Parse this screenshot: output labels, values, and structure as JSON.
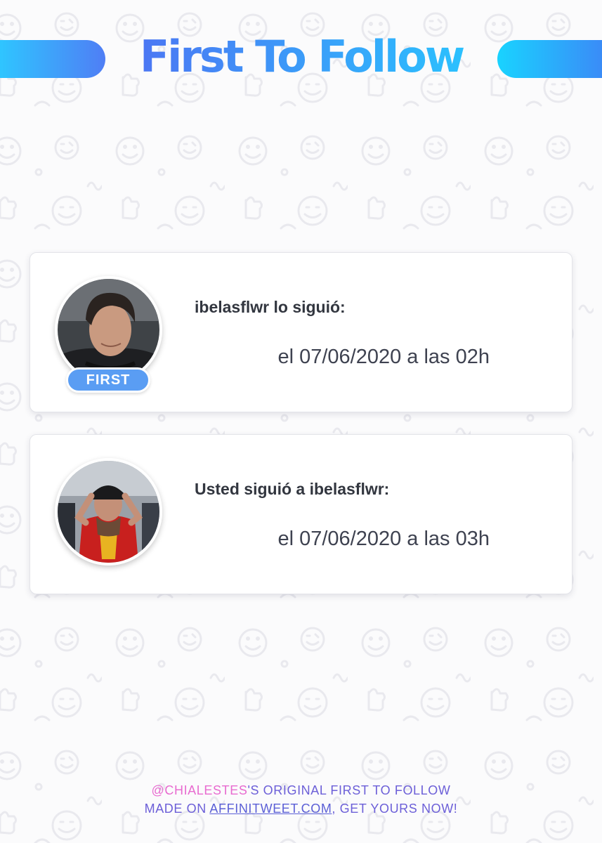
{
  "header": {
    "title": "First To Follow"
  },
  "cards": [
    {
      "label": "ibelasflwr lo siguió:",
      "date": "el 07/06/2020 a las 02h",
      "badge": "FIRST",
      "avatar": "young man with dark hair, headphones around neck"
    },
    {
      "label": "Usted siguió a ibelasflwr:",
      "date": "el 07/06/2020 a las 03h",
      "avatar": "person in red football jersey and black cap, hands on head"
    }
  ],
  "footer": {
    "handle": "@CHIALESTES",
    "line1_rest": "'S ORIGINAL FIRST TO FOLLOW",
    "line2_prefix": "MADE ON ",
    "site": "AFFINITWEET.COM",
    "line2_suffix": ", GET YOURS NOW!"
  },
  "colors": {
    "title_gradient": [
      "#4f6ff2",
      "#28c8ff"
    ],
    "badge": "#5a9df3",
    "footer_handle": "#e86bd0",
    "footer_text": "#6c5fd8",
    "pattern": "#ececf0"
  },
  "icons": {
    "pattern": [
      "smiley-icon",
      "thumbs-up-icon",
      "ok-hand-icon",
      "wink-icon"
    ]
  }
}
